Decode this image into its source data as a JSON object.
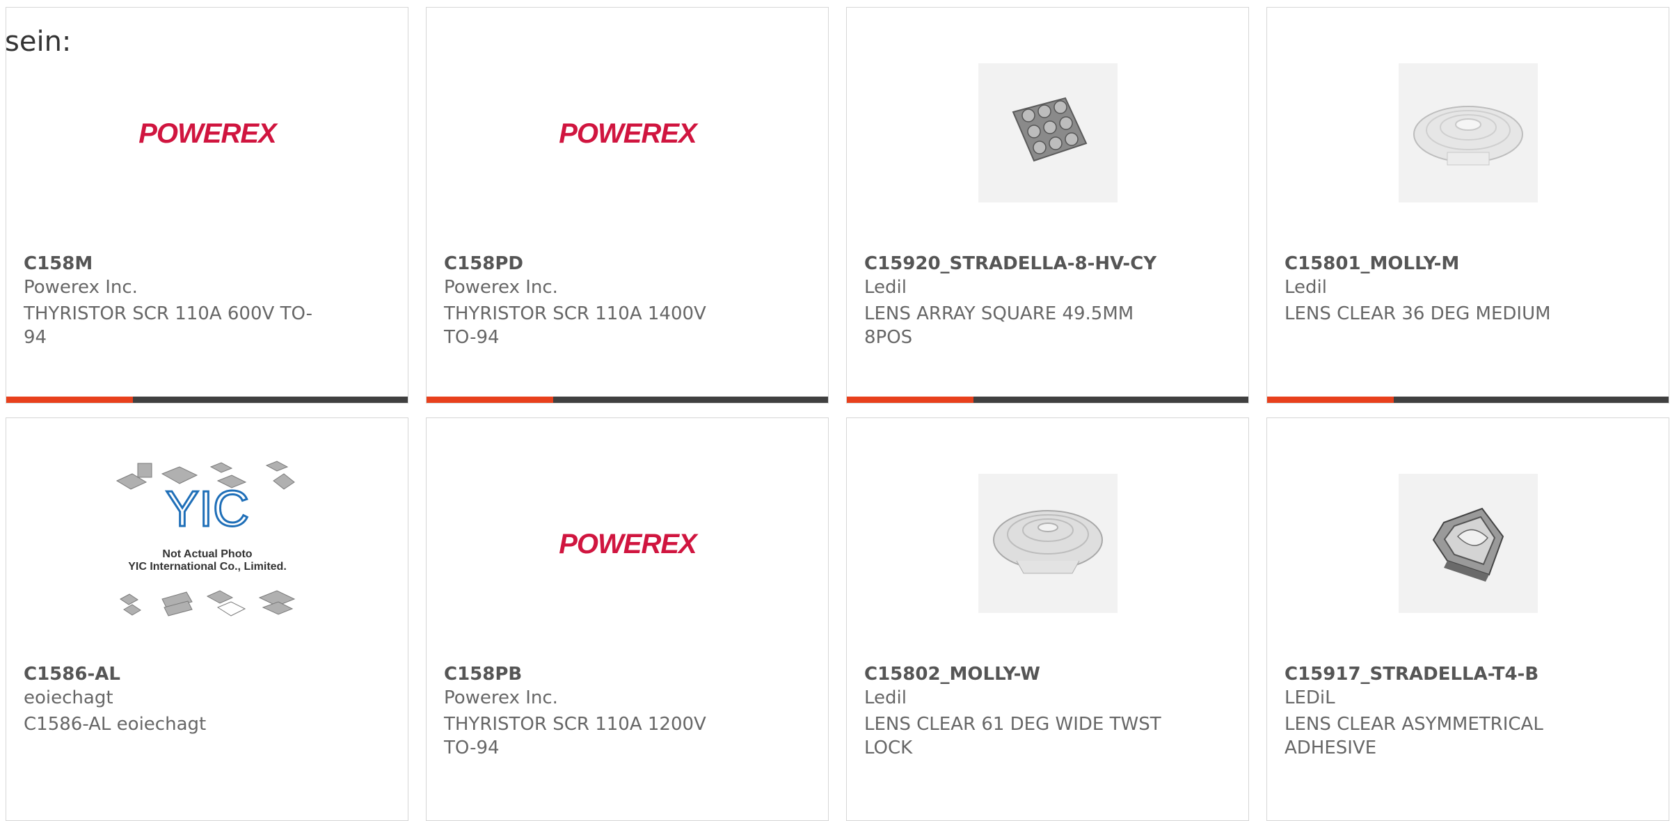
{
  "page_label": "sein:",
  "brand_colors": {
    "powerex_red": "#d0153f",
    "bar_dark": "#404040",
    "bar_accent": "#e8401c",
    "yic_blue": "#1f6fb8"
  },
  "products": [
    {
      "part_no": "C158M",
      "manufacturer": "Powerex Inc.",
      "description": "THYRISTOR SCR 110A 600V TO-94",
      "image": "powerex-logo",
      "logo_text": "POWEREX"
    },
    {
      "part_no": "C158PD",
      "manufacturer": "Powerex Inc.",
      "description": "THYRISTOR SCR 110A 1400V TO-94",
      "image": "powerex-logo",
      "logo_text": "POWEREX"
    },
    {
      "part_no": "C15920_STRADELLA-8-HV-CY",
      "manufacturer": "Ledil",
      "description": "LENS ARRAY SQUARE 49.5MM 8POS",
      "image": "lens-array-photo"
    },
    {
      "part_no": "C15801_MOLLY-M",
      "manufacturer": "Ledil",
      "description": "LENS CLEAR 36 DEG MEDIUM",
      "image": "round-lens-photo"
    },
    {
      "part_no": "C1586-AL",
      "manufacturer": "eoiechagt",
      "description": "C1586-AL eoiechagt",
      "image": "yic-placeholder",
      "placeholder_line1": "Not Actual Photo",
      "placeholder_line2": "YIC International Co., Limited."
    },
    {
      "part_no": "C158PB",
      "manufacturer": "Powerex Inc.",
      "description": "THYRISTOR SCR 110A 1200V TO-94",
      "image": "powerex-logo",
      "logo_text": "POWEREX"
    },
    {
      "part_no": "C15802_MOLLY-W",
      "manufacturer": "Ledil",
      "description": "LENS CLEAR 61 DEG WIDE TWST LOCK",
      "image": "round-lens-photo"
    },
    {
      "part_no": "C15917_STRADELLA-T4-B",
      "manufacturer": "LEDiL",
      "description": "LENS CLEAR ASYMMETRICAL ADHESIVE",
      "image": "asymmetric-lens-photo"
    }
  ]
}
